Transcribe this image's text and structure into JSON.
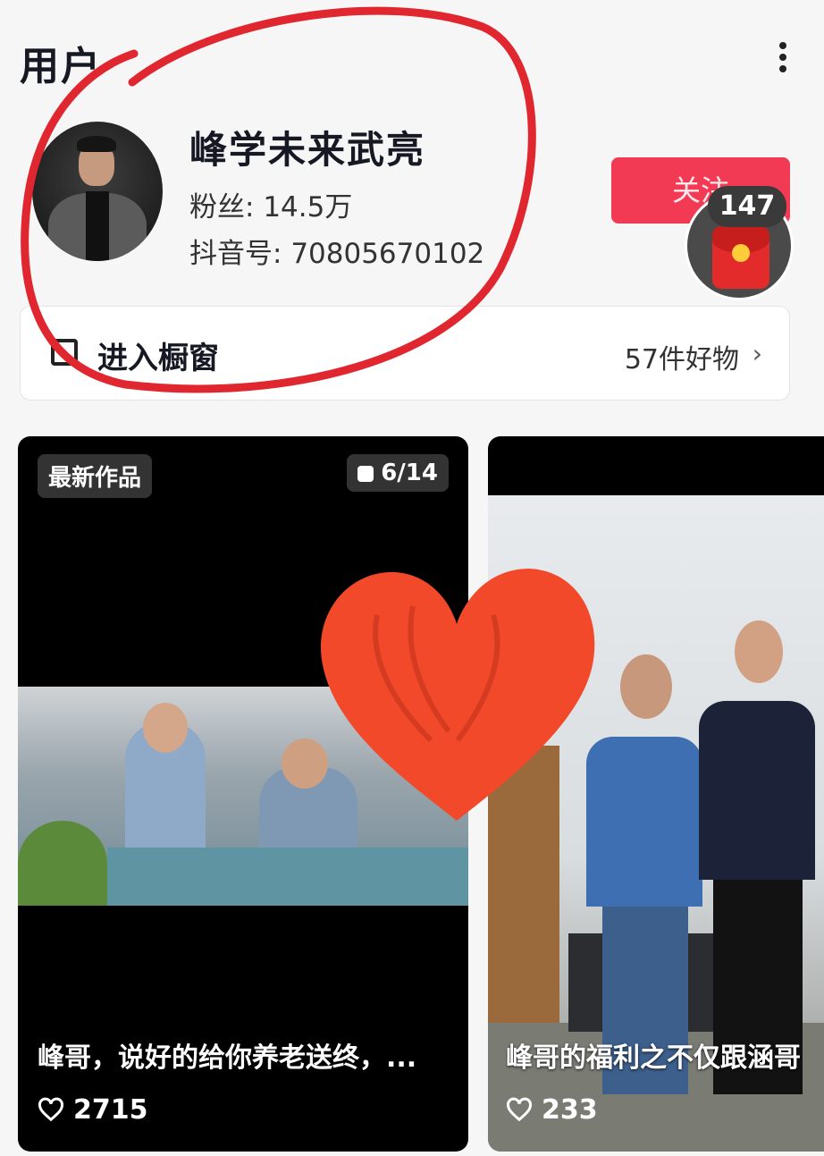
{
  "header": {
    "title": "用户"
  },
  "profile": {
    "name": "峰学未来武亮",
    "fans_label": "粉丝:",
    "fans_value": "14.5万",
    "douyin_id_label": "抖音号:",
    "douyin_id_value": "70805670102",
    "follow_label": "关注",
    "red_packet_count": "147"
  },
  "shop": {
    "label": "进入橱窗",
    "count": "57件好物",
    "chevron": "›"
  },
  "cards": [
    {
      "tag": "最新作品",
      "counter": "6/14",
      "caption": "峰哥，说好的给你养老送终，...",
      "likes": "2715"
    },
    {
      "caption": "峰哥的福利之不仅跟涵哥",
      "likes": "233"
    }
  ],
  "colors": {
    "accent": "#f23a55",
    "annotation_red": "#e0262e",
    "heart": "#f2492a"
  }
}
